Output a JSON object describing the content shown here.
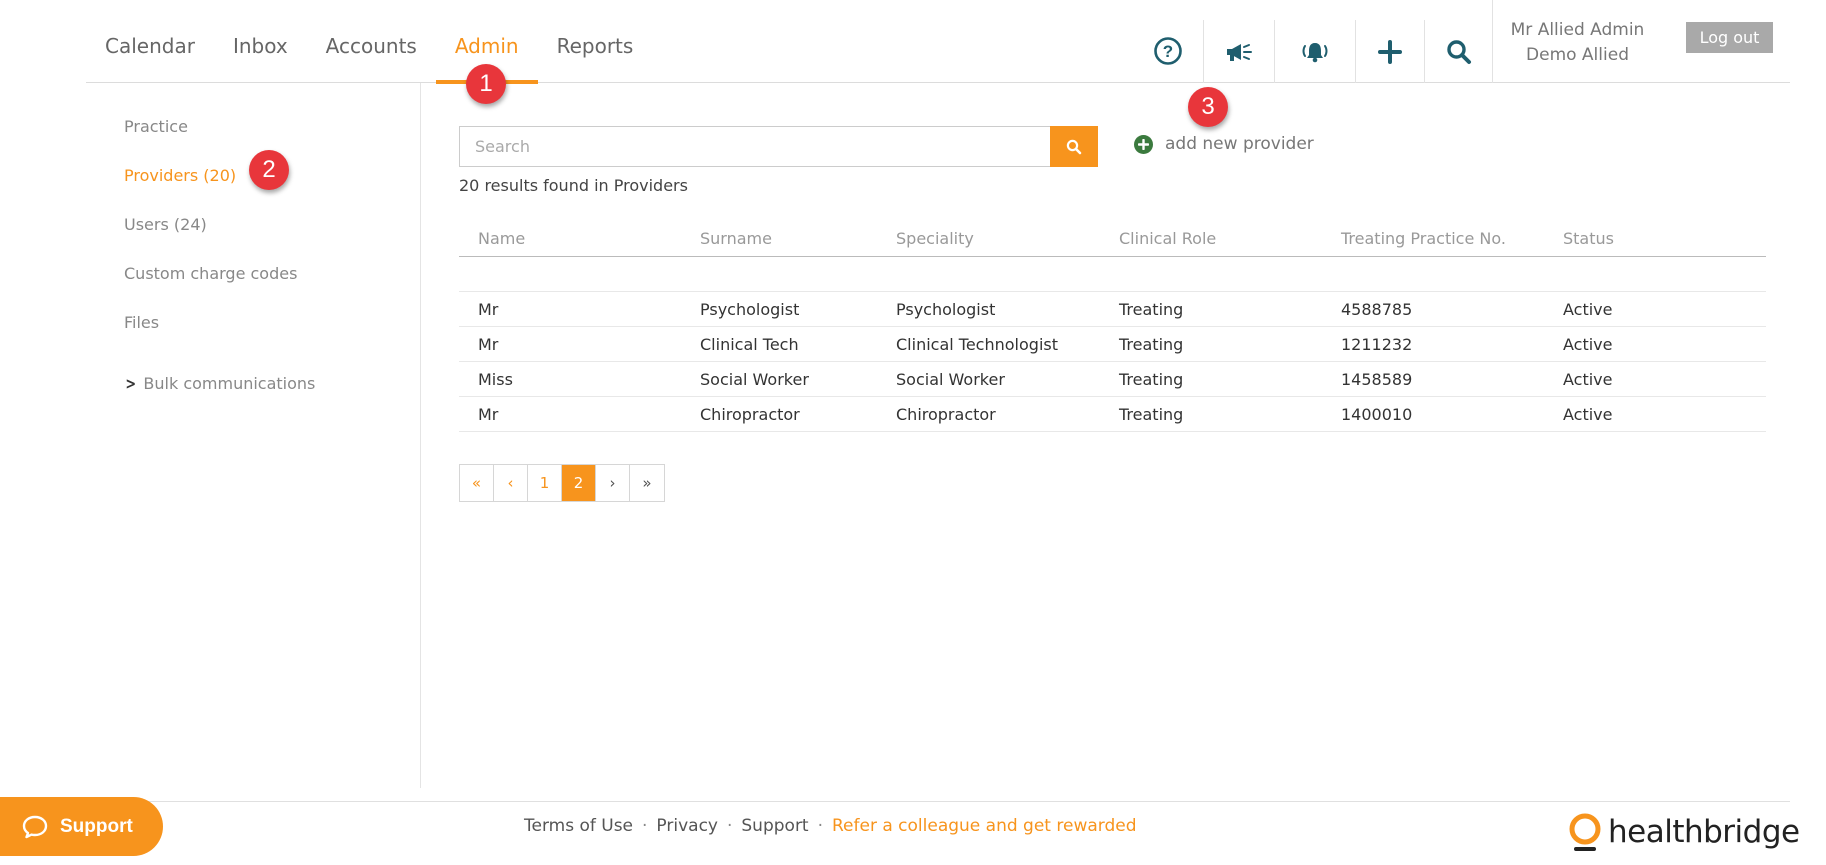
{
  "nav": {
    "tabs": [
      {
        "label": "Calendar"
      },
      {
        "label": "Inbox"
      },
      {
        "label": "Accounts"
      },
      {
        "label": "Admin",
        "active": true
      },
      {
        "label": "Reports"
      }
    ],
    "icons": [
      "help-icon",
      "megaphone-icon",
      "notification-bell-icon",
      "add-icon",
      "search-icon"
    ],
    "user": {
      "name": "Mr Allied Admin",
      "practice": "Demo Allied"
    },
    "logout_label": "Log out"
  },
  "sidebar": {
    "items": [
      {
        "label": "Practice"
      },
      {
        "label": "Providers (20)",
        "active": true
      },
      {
        "label": "Users (24)"
      },
      {
        "label": "Custom charge codes"
      },
      {
        "label": "Files"
      },
      {
        "label": "Bulk communications",
        "icon": "chevron-right-icon"
      }
    ]
  },
  "main": {
    "search": {
      "placeholder": "Search",
      "value": ""
    },
    "add_label": "add new provider",
    "results": "20 results found in Providers",
    "table": {
      "columns": [
        "Name",
        "Surname",
        "Speciality",
        "Clinical Role",
        "Treating Practice No.",
        "Status"
      ],
      "rows": [
        [
          "Mr",
          "Psychologist",
          "Psychologist",
          "Treating",
          "4588785",
          "Active"
        ],
        [
          "Mr",
          "Clinical Tech",
          "Clinical Technologist",
          "Treating",
          "1211232",
          "Active"
        ],
        [
          "Miss",
          "Social Worker",
          "Social Worker",
          "Treating",
          "1458589",
          "Active"
        ],
        [
          "Mr",
          "Chiropractor",
          "Chiropractor",
          "Treating",
          "1400010",
          "Active"
        ]
      ]
    },
    "pagination": {
      "first": "«",
      "prev": "‹",
      "pages": [
        "1",
        "2"
      ],
      "current": "2",
      "next": "›",
      "last": "»"
    }
  },
  "markers": [
    "1",
    "2",
    "3"
  ],
  "footer": {
    "support_label": "Support",
    "links": [
      "Terms of Use",
      "Privacy",
      "Support"
    ],
    "separator": "·",
    "promo": "Refer a colleague and get rewarded",
    "logo_text": "healthbridge"
  },
  "colors": {
    "accent": "#f7941d",
    "icon": "#1f5e6e",
    "marker": "#e8363b",
    "add_icon": "#3b7a3e"
  }
}
